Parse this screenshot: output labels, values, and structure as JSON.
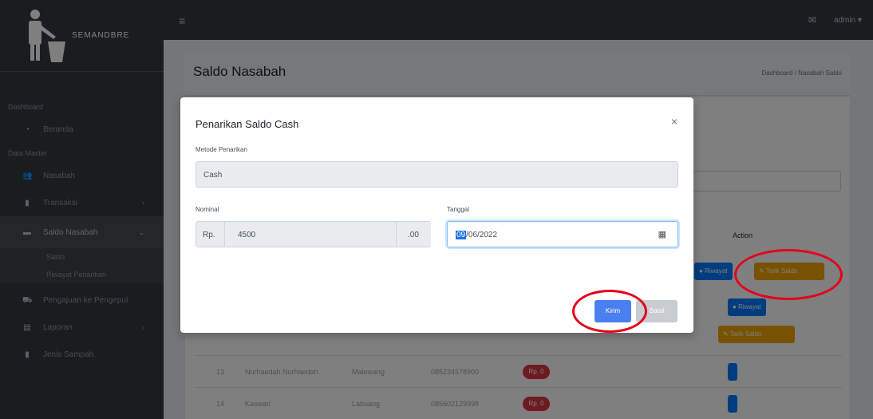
{
  "brand": {
    "name": "SEMANDBRE"
  },
  "navbar": {
    "hamburger_icon": "bars-icon",
    "mail_icon": "envelope-icon",
    "user": "admin",
    "user_caret": "▾"
  },
  "sidebar": {
    "sections": [
      {
        "header": "Dashboard",
        "items": [
          {
            "label": "Beranda",
            "icon": "gauge-icon"
          }
        ]
      },
      {
        "header": "Data Master",
        "items": [
          {
            "label": "Nasabah",
            "icon": "users-icon"
          },
          {
            "label": "Transaksi",
            "icon": "file-icon",
            "chevron": "›"
          },
          {
            "label": "Saldo Nasabah",
            "icon": "wallet-icon",
            "chevron": "⌄",
            "active": true,
            "subitems": [
              "Saldo",
              "Riwayat Penarikan"
            ]
          },
          {
            "label": "Pengajuan ke Pengepul",
            "icon": "truck-icon"
          },
          {
            "label": "Laporan",
            "icon": "book-icon",
            "chevron": "›"
          },
          {
            "label": "Jenis Sampah",
            "icon": "trash-icon"
          }
        ]
      }
    ]
  },
  "page": {
    "title": "Saldo Nasabah",
    "breadcrumb": "Dashboard / Nasabah Saldo"
  },
  "table": {
    "action_header": "Action",
    "rows": [
      {
        "no": "13",
        "name": "Nurhaedah Nurhaedah",
        "address": "Malewang",
        "phone": "085234578900",
        "saldo": "Rp. 0",
        "buttons": [
          "Riwayat"
        ]
      },
      {
        "no": "14",
        "name": "Kaswari",
        "address": "Labuang",
        "phone": "085602129998",
        "saldo": "Rp. 0",
        "buttons": [
          "Riwayat"
        ]
      }
    ],
    "behind_buttons": {
      "riwayat": "Riwayat",
      "tarik_saldo": "Tarik Saldo",
      "tarik_cash": "Tarik Saldo"
    }
  },
  "modal": {
    "title": "Penarikan Saldo Cash",
    "close": "×",
    "method_label": "Metode Penarikan",
    "method_value": "Cash",
    "amount_label": "Nominal",
    "amount_prefix": "Rp.",
    "amount_value": "4500",
    "amount_suffix": ".00",
    "date_label": "Tanggal",
    "date_day": "09",
    "date_rest": "/06/2022",
    "calendar_icon": "calendar-icon",
    "save_label": "Kirim",
    "cancel_label": "Batal"
  },
  "colors": {
    "sidebar": "#343a40",
    "primary": "#007bff",
    "warning": "#f0a500",
    "danger": "#dc3545",
    "annotation": "#e3001b"
  }
}
